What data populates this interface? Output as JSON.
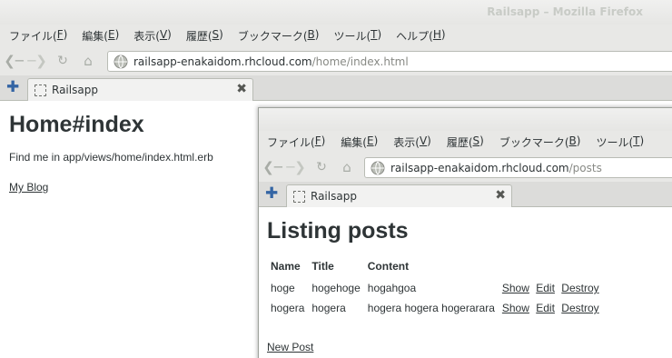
{
  "window1": {
    "title": "Railsapp – Mozilla Firefox",
    "menu": [
      {
        "label": "ファイル(",
        "key": "F",
        "tail": ")"
      },
      {
        "label": "編集(",
        "key": "E",
        "tail": ")"
      },
      {
        "label": "表示(",
        "key": "V",
        "tail": ")"
      },
      {
        "label": "履歴(",
        "key": "S",
        "tail": ")"
      },
      {
        "label": "ブックマーク(",
        "key": "B",
        "tail": ")"
      },
      {
        "label": "ツール(",
        "key": "T",
        "tail": ")"
      },
      {
        "label": "ヘルプ(",
        "key": "H",
        "tail": ")"
      }
    ],
    "url_host": "railsapp-enakaidom.rhcloud.com",
    "url_path": "/home/index.html",
    "tab_title": "Railsapp",
    "page": {
      "heading": "Home#index",
      "note": "Find me in app/views/home/index.html.erb",
      "link": "My Blog"
    }
  },
  "window2": {
    "menu": [
      {
        "label": "ファイル(",
        "key": "F",
        "tail": ")"
      },
      {
        "label": "編集(",
        "key": "E",
        "tail": ")"
      },
      {
        "label": "表示(",
        "key": "V",
        "tail": ")"
      },
      {
        "label": "履歴(",
        "key": "S",
        "tail": ")"
      },
      {
        "label": "ブックマーク(",
        "key": "B",
        "tail": ")"
      },
      {
        "label": "ツール(",
        "key": "T",
        "tail": ")"
      }
    ],
    "url_host": "railsapp-enakaidom.rhcloud.com",
    "url_path": "/posts",
    "tab_title": "Railsapp",
    "page": {
      "heading": "Listing posts",
      "columns": [
        "Name",
        "Title",
        "Content"
      ],
      "rows": [
        {
          "name": "hoge",
          "title": "hogehoge",
          "content": "hogahgoa",
          "show": "Show",
          "edit": "Edit",
          "destroy": "Destroy"
        },
        {
          "name": "hogera",
          "title": "hogera",
          "content": "hogera hogera hogerarara",
          "show": "Show",
          "edit": "Edit",
          "destroy": "Destroy"
        }
      ],
      "new_post": "New Post"
    }
  },
  "icons": {
    "back": "back-arrow-icon",
    "forward": "forward-arrow-icon",
    "reload": "reload-icon",
    "home": "home-icon",
    "site": "globe-icon",
    "new_tab": "plus-icon",
    "close_tab": "close-icon"
  },
  "colors": {
    "chrome": "#e8e8e6",
    "text": "#2e3436",
    "accent_plus": "#3465a4",
    "url_path": "#888a85"
  }
}
